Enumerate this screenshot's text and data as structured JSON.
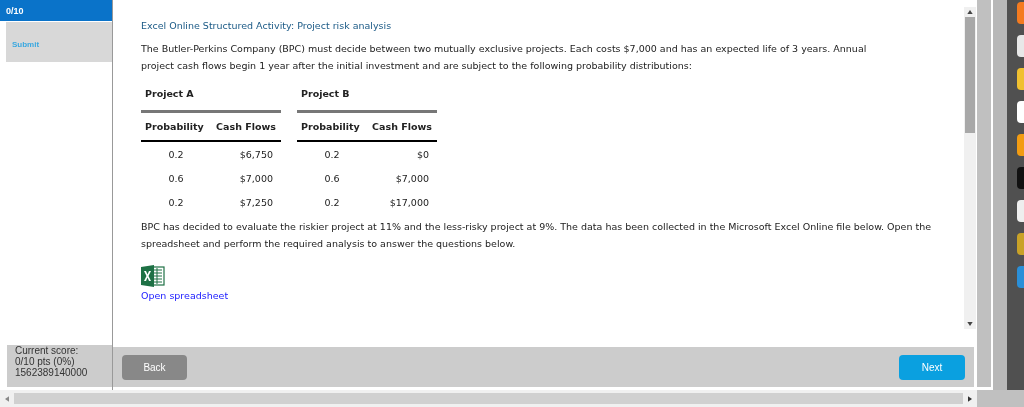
{
  "sidebar": {
    "question_score": "0/10",
    "submit": "Submit",
    "current_score": {
      "label": "Current score:",
      "points": "0/10 pts (0%)",
      "id": "1562389140000"
    }
  },
  "title": "Excel Online Structured Activity: Project risk analysis",
  "intro": "The Butler-Perkins Company (BPC) must decide between two mutually exclusive projects. Each costs $7,000 and has an expected life of 3 years. Annual project cash flows begin 1 year after the initial investment and are subject to the following probability distributions:",
  "projects": [
    {
      "name": "Project A",
      "columns": [
        "Probability",
        "Cash Flows"
      ],
      "rows": [
        [
          "0.2",
          "$6,750"
        ],
        [
          "0.6",
          "$7,000"
        ],
        [
          "0.2",
          "$7,250"
        ]
      ]
    },
    {
      "name": "Project B",
      "columns": [
        "Probability",
        "Cash Flows"
      ],
      "rows": [
        [
          "0.2",
          "$0"
        ],
        [
          "0.6",
          "$7,000"
        ],
        [
          "0.2",
          "$17,000"
        ]
      ]
    }
  ],
  "decision_text": "BPC has decided to evaluate the riskier project at 11% and the less-risky project at 9%. The data has been collected in the Microsoft Excel Online file below. Open the spreadsheet and perform the required analysis to answer the questions below.",
  "spreadsheet_link": "Open spreadsheet",
  "buttons": {
    "back": "Back",
    "next": "Next"
  }
}
